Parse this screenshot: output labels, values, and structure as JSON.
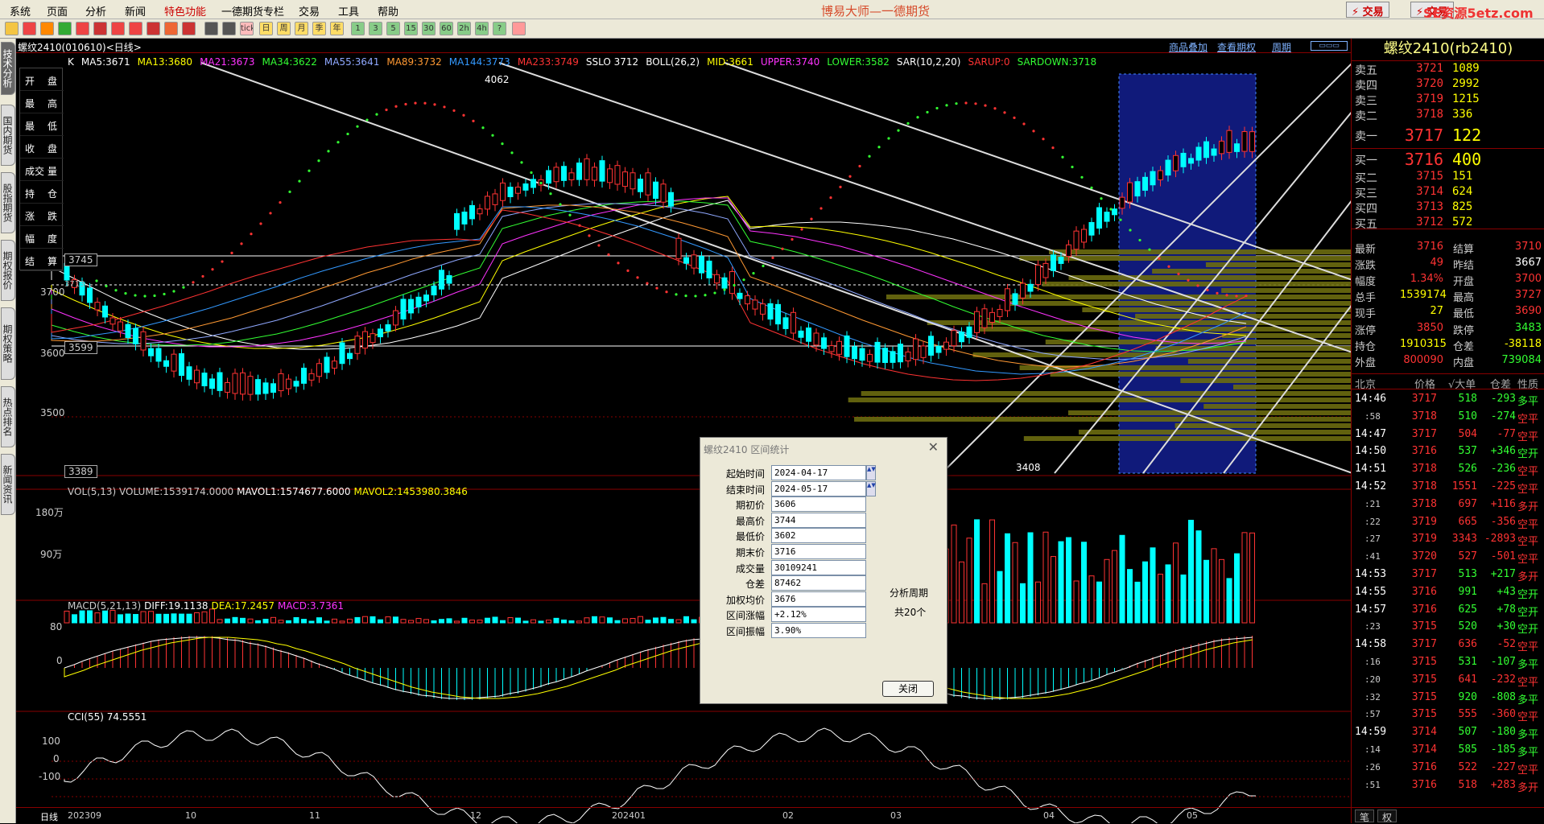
{
  "app": {
    "title": "博易大师—一德期货",
    "menu": [
      "系统",
      "页面",
      "分析",
      "新闻",
      "特色功能",
      "一德期货专栏",
      "交易",
      "工具",
      "帮助"
    ],
    "trade_button": "⚡ 交易",
    "trade_button2": "⚡ 交易",
    "watermark": "SE资源5etz.com"
  },
  "toolbar": {
    "icons": [
      "back-icon",
      "home-icon",
      "book-icon",
      "refresh-icon",
      "window-icon",
      "search-icon",
      "zoom-in-icon",
      "zoom-out-icon",
      "pen-icon",
      "paint-icon",
      "cup-icon",
      "table-icon",
      "list-icon",
      "tick-icon",
      "day-icon",
      "week-icon",
      "month-icon",
      "season-icon",
      "year-icon",
      "1min-icon",
      "3min-icon",
      "5min-icon",
      "15min-icon",
      "30min-icon",
      "60min-icon",
      "2h-icon",
      "4h-icon",
      "custom-icon",
      "calc-icon"
    ],
    "labels": [
      "",
      "",
      "",
      "",
      "",
      "",
      "",
      "",
      "",
      "",
      "",
      "",
      "",
      "tick",
      "日",
      "周",
      "月",
      "季",
      "年",
      "1",
      "3",
      "5",
      "15",
      "30",
      "60",
      "2h",
      "4h",
      "?",
      ""
    ]
  },
  "left_tabs": [
    "技术分析",
    "国内期货",
    "股指期货",
    "期权报价",
    "期权策略",
    "热点排名",
    "新闻资讯"
  ],
  "chart": {
    "symbol": "螺纹2410(010610)<日线>",
    "links": [
      "商品叠加",
      "查看期权",
      "周期"
    ],
    "indicators": [
      {
        "text": "K",
        "color": "#ffffff"
      },
      {
        "text": "MA5:3671",
        "color": "#ffffff"
      },
      {
        "text": "MA13:3680",
        "color": "#ffff00"
      },
      {
        "text": "MA21:3673",
        "color": "#ff33ff"
      },
      {
        "text": "MA34:3622",
        "color": "#33ff33"
      },
      {
        "text": "MA55:3641",
        "color": "#8fa8ff"
      },
      {
        "text": "MA89:3732",
        "color": "#ff9933"
      },
      {
        "text": "MA144:3773",
        "color": "#3399ff"
      },
      {
        "text": "MA233:3749",
        "color": "#ff3333"
      },
      {
        "text": "SSLO 3712",
        "color": "#ffffff"
      },
      {
        "text": "BOLL(26,2)",
        "color": "#ffffff"
      },
      {
        "text": "MID:3661",
        "color": "#ffff00"
      },
      {
        "text": "UPPER:3740",
        "color": "#ff33ff"
      },
      {
        "text": "LOWER:3582",
        "color": "#33ff33"
      },
      {
        "text": "SAR(10,2,20)",
        "color": "#ffffff"
      },
      {
        "text": "SARUP:0",
        "color": "#ff3333"
      },
      {
        "text": "SARDOWN:3718",
        "color": "#33ff33"
      }
    ],
    "fields": [
      [
        "开",
        "盘"
      ],
      [
        "最",
        "高"
      ],
      [
        "最",
        "低"
      ],
      [
        "收",
        "盘"
      ],
      [
        "成交",
        "量"
      ],
      [
        "持",
        "仓"
      ],
      [
        "涨",
        "跌"
      ],
      [
        "幅",
        "度"
      ],
      [
        "结",
        "算"
      ]
    ],
    "price_labels": {
      "p3745": "3745",
      "p3700": "3700",
      "p3600": "3600",
      "p3599": "3599",
      "p3500": "3500",
      "p3389": "3389",
      "high": "4062",
      "low": "3408",
      "cursor": "3713"
    },
    "volume_title": [
      {
        "text": "VOL(5,13) VOLUME:1539174.0000",
        "color": "#cccccc"
      },
      {
        "text": "MAVOL1:1574677.6000",
        "color": "#ffffff"
      },
      {
        "text": "MAVOL2:1453980.3846",
        "color": "#ffff00"
      }
    ],
    "volume_ticks": [
      "180万",
      "90万"
    ],
    "macd_title": [
      {
        "text": "MACD(5,21,13)",
        "color": "#cccccc"
      },
      {
        "text": "DIFF:19.1138",
        "color": "#ffffff"
      },
      {
        "text": "DEA:17.2457",
        "color": "#ffff00"
      },
      {
        "text": "MACD:3.7361",
        "color": "#ff33ff"
      }
    ],
    "macd_ticks": [
      "80",
      "0"
    ],
    "cci_title": [
      {
        "text": "CCI(55) 74.5551",
        "color": "#ffffff"
      }
    ],
    "cci_ticks": [
      "100",
      "0",
      "-100"
    ],
    "xaxis": [
      "日线",
      "202309",
      "10",
      "11",
      "12",
      "202401",
      "02",
      "03",
      "04",
      "05"
    ]
  },
  "dialog": {
    "title": "螺纹2410 区间统计",
    "rows": [
      {
        "label": "起始时间",
        "value": "2024-04-17"
      },
      {
        "label": "结束时间",
        "value": "2024-05-17"
      },
      {
        "label": "期初价",
        "value": "3606"
      },
      {
        "label": "最高价",
        "value": "3744"
      },
      {
        "label": "最低价",
        "value": "3602"
      },
      {
        "label": "期末价",
        "value": "3716"
      },
      {
        "label": "成交量",
        "value": "30109241"
      },
      {
        "label": "仓差",
        "value": "87462"
      },
      {
        "label": "加权均价",
        "value": "3676"
      },
      {
        "label": "区间涨幅",
        "value": "+2.12%"
      },
      {
        "label": "区间振幅",
        "value": "3.90%"
      }
    ],
    "period_label": "分析周期",
    "period_count": "共20个",
    "close_button": "关闭"
  },
  "quote": {
    "title": "螺纹2410(rb2410)",
    "asks": [
      {
        "name": "卖五",
        "price": "3721",
        "vol": "1089"
      },
      {
        "name": "卖四",
        "price": "3720",
        "vol": "2992"
      },
      {
        "name": "卖三",
        "price": "3719",
        "vol": "1215"
      },
      {
        "name": "卖二",
        "price": "3718",
        "vol": "336"
      },
      {
        "name": "卖一",
        "price": "3717",
        "vol": "122"
      }
    ],
    "bids": [
      {
        "name": "买一",
        "price": "3716",
        "vol": "400"
      },
      {
        "name": "买二",
        "price": "3715",
        "vol": "151"
      },
      {
        "name": "买三",
        "price": "3714",
        "vol": "624"
      },
      {
        "name": "买四",
        "price": "3713",
        "vol": "825"
      },
      {
        "name": "买五",
        "price": "3712",
        "vol": "572"
      }
    ],
    "stats": [
      {
        "l1": "最新",
        "v1": "3716",
        "c1": "c-red",
        "l2": "结算",
        "v2": "3710",
        "c2": "c-red"
      },
      {
        "l1": "涨跌",
        "v1": "49",
        "c1": "c-red",
        "l2": "昨结",
        "v2": "3667",
        "c2": "c-wht"
      },
      {
        "l1": "幅度",
        "v1": "1.34%",
        "c1": "c-red",
        "l2": "开盘",
        "v2": "3700",
        "c2": "c-red"
      },
      {
        "l1": "总手",
        "v1": "1539174",
        "c1": "c-yel",
        "l2": "最高",
        "v2": "3727",
        "c2": "c-red"
      },
      {
        "l1": "现手",
        "v1": "27",
        "c1": "c-yel",
        "l2": "最低",
        "v2": "3690",
        "c2": "c-red"
      },
      {
        "l1": "涨停",
        "v1": "3850",
        "c1": "c-red",
        "l2": "跌停",
        "v2": "3483",
        "c2": "c-grn"
      },
      {
        "l1": "持仓",
        "v1": "1910315",
        "c1": "c-yel",
        "l2": "仓差",
        "v2": "-38118",
        "c2": "c-yel"
      },
      {
        "l1": "外盘",
        "v1": "800090",
        "c1": "c-red",
        "l2": "内盘",
        "v2": "739084",
        "c2": "c-grn"
      }
    ],
    "tick_head": [
      "北京",
      "价格",
      "√大单",
      "仓差",
      "性质"
    ],
    "ticks": [
      {
        "t": "14:46",
        "pr": "3717",
        "vo": "518",
        "oi": "-293",
        "na": "多平",
        "vc": "c-grn",
        "nc": "c-grn"
      },
      {
        "t": ":58",
        "pr": "3718",
        "vo": "510",
        "oi": "-274",
        "na": "空平",
        "vc": "c-grn",
        "nc": "c-red"
      },
      {
        "t": "14:47",
        "pr": "3717",
        "vo": "504",
        "oi": "-77",
        "na": "空平",
        "vc": "c-red",
        "nc": "c-red"
      },
      {
        "t": "14:50",
        "pr": "3716",
        "vo": "537",
        "oi": "+346",
        "na": "空开",
        "vc": "c-grn",
        "nc": "c-grn"
      },
      {
        "t": "14:51",
        "pr": "3718",
        "vo": "526",
        "oi": "-236",
        "na": "空平",
        "vc": "c-grn",
        "nc": "c-red"
      },
      {
        "t": "14:52",
        "pr": "3718",
        "vo": "1551",
        "oi": "-225",
        "na": "空平",
        "vc": "c-red",
        "nc": "c-red"
      },
      {
        "t": ":21",
        "pr": "3718",
        "vo": "697",
        "oi": "+116",
        "na": "多开",
        "vc": "c-red",
        "nc": "c-red"
      },
      {
        "t": ":22",
        "pr": "3719",
        "vo": "665",
        "oi": "-356",
        "na": "空平",
        "vc": "c-red",
        "nc": "c-red"
      },
      {
        "t": ":27",
        "pr": "3719",
        "vo": "3343",
        "oi": "-2893",
        "na": "空平",
        "vc": "c-red",
        "nc": "c-red"
      },
      {
        "t": ":41",
        "pr": "3720",
        "vo": "527",
        "oi": "-501",
        "na": "空平",
        "vc": "c-red",
        "nc": "c-red"
      },
      {
        "t": "14:53",
        "pr": "3717",
        "vo": "513",
        "oi": "+217",
        "na": "多开",
        "vc": "c-grn",
        "nc": "c-red"
      },
      {
        "t": "14:55",
        "pr": "3716",
        "vo": "991",
        "oi": "+43",
        "na": "空开",
        "vc": "c-grn",
        "nc": "c-grn"
      },
      {
        "t": "14:57",
        "pr": "3716",
        "vo": "625",
        "oi": "+78",
        "na": "空开",
        "vc": "c-grn",
        "nc": "c-grn"
      },
      {
        "t": ":23",
        "pr": "3715",
        "vo": "520",
        "oi": "+30",
        "na": "空开",
        "vc": "c-grn",
        "nc": "c-grn"
      },
      {
        "t": "14:58",
        "pr": "3717",
        "vo": "636",
        "oi": "-52",
        "na": "空平",
        "vc": "c-red",
        "nc": "c-red"
      },
      {
        "t": ":16",
        "pr": "3715",
        "vo": "531",
        "oi": "-107",
        "na": "多平",
        "vc": "c-grn",
        "nc": "c-grn"
      },
      {
        "t": ":20",
        "pr": "3715",
        "vo": "641",
        "oi": "-232",
        "na": "空平",
        "vc": "c-red",
        "nc": "c-red"
      },
      {
        "t": ":32",
        "pr": "3715",
        "vo": "920",
        "oi": "-808",
        "na": "多平",
        "vc": "c-grn",
        "nc": "c-grn"
      },
      {
        "t": ":57",
        "pr": "3715",
        "vo": "555",
        "oi": "-360",
        "na": "空平",
        "vc": "c-red",
        "nc": "c-red"
      },
      {
        "t": "14:59",
        "pr": "3714",
        "vo": "507",
        "oi": "-180",
        "na": "多平",
        "vc": "c-grn",
        "nc": "c-grn"
      },
      {
        "t": ":14",
        "pr": "3714",
        "vo": "585",
        "oi": "-185",
        "na": "多平",
        "vc": "c-grn",
        "nc": "c-grn"
      },
      {
        "t": ":26",
        "pr": "3716",
        "vo": "522",
        "oi": "-227",
        "na": "空平",
        "vc": "c-red",
        "nc": "c-red"
      },
      {
        "t": ":51",
        "pr": "3716",
        "vo": "518",
        "oi": "+283",
        "na": "多开",
        "vc": "c-red",
        "nc": "c-red"
      }
    ],
    "bottom_tabs": [
      "笔",
      "权"
    ]
  }
}
